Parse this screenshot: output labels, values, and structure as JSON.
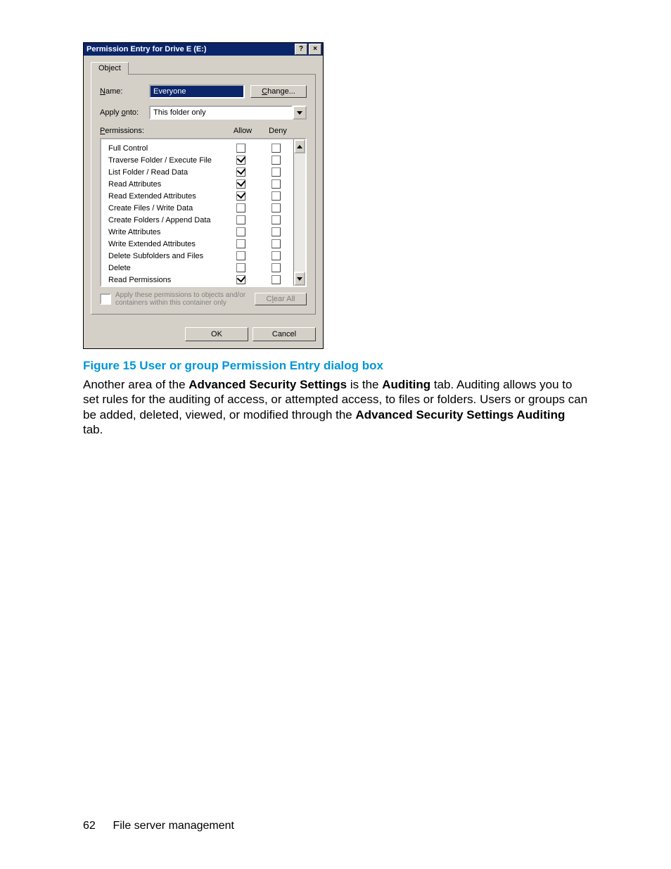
{
  "dialog": {
    "title": "Permission Entry for Drive E (E:)",
    "tab": "Object",
    "name_label": "Name:",
    "name_value": "Everyone",
    "change_btn": "Change...",
    "apply_onto_label": "Apply onto:",
    "apply_onto_value": "This folder only",
    "perm_label": "Permissions:",
    "col_allow": "Allow",
    "col_deny": "Deny",
    "rows": [
      {
        "name": "Full Control",
        "allow": false,
        "deny": false
      },
      {
        "name": "Traverse Folder / Execute File",
        "allow": true,
        "deny": false
      },
      {
        "name": "List Folder / Read Data",
        "allow": true,
        "deny": false
      },
      {
        "name": "Read Attributes",
        "allow": true,
        "deny": false
      },
      {
        "name": "Read Extended Attributes",
        "allow": true,
        "deny": false
      },
      {
        "name": "Create Files / Write Data",
        "allow": false,
        "deny": false
      },
      {
        "name": "Create Folders / Append Data",
        "allow": false,
        "deny": false
      },
      {
        "name": "Write Attributes",
        "allow": false,
        "deny": false
      },
      {
        "name": "Write Extended Attributes",
        "allow": false,
        "deny": false
      },
      {
        "name": "Delete Subfolders and Files",
        "allow": false,
        "deny": false
      },
      {
        "name": "Delete",
        "allow": false,
        "deny": false
      },
      {
        "name": "Read Permissions",
        "allow": true,
        "deny": false
      }
    ],
    "apply_these": "Apply these permissions to objects and/or containers within this container only",
    "clear_all": "Clear All",
    "ok": "OK",
    "cancel": "Cancel"
  },
  "caption": "Figure 15 User or group Permission Entry dialog box",
  "para": {
    "t1": "Another area of the ",
    "b1": "Advanced Security Settings",
    "t2": " is the ",
    "b2": "Auditing",
    "t3": " tab. Auditing allows you to set rules for the auditing of access, or attempted access, to files or folders. Users or groups can be added, deleted, viewed, or modified through the ",
    "b3": "Advanced Security Settings Auditing",
    "t4": " tab."
  },
  "footer": {
    "page": "62",
    "section": "File server management"
  }
}
